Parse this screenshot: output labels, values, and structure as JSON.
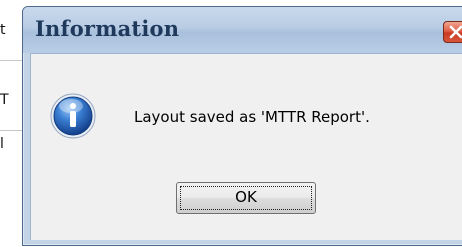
{
  "dialog": {
    "title": "Information",
    "message": "Layout saved as 'MTTR Report'.",
    "ok_label": "OK"
  },
  "background_chars": [
    "t",
    "T",
    "l"
  ],
  "colors": {
    "title_text": "#1e395b",
    "titlebar": "#b8cce4",
    "close_button": "#d6573b",
    "body_bg": "#f0f0f0",
    "info_icon": "#1f5fb4"
  },
  "icons": {
    "close": "close-icon",
    "info": "information-icon"
  }
}
